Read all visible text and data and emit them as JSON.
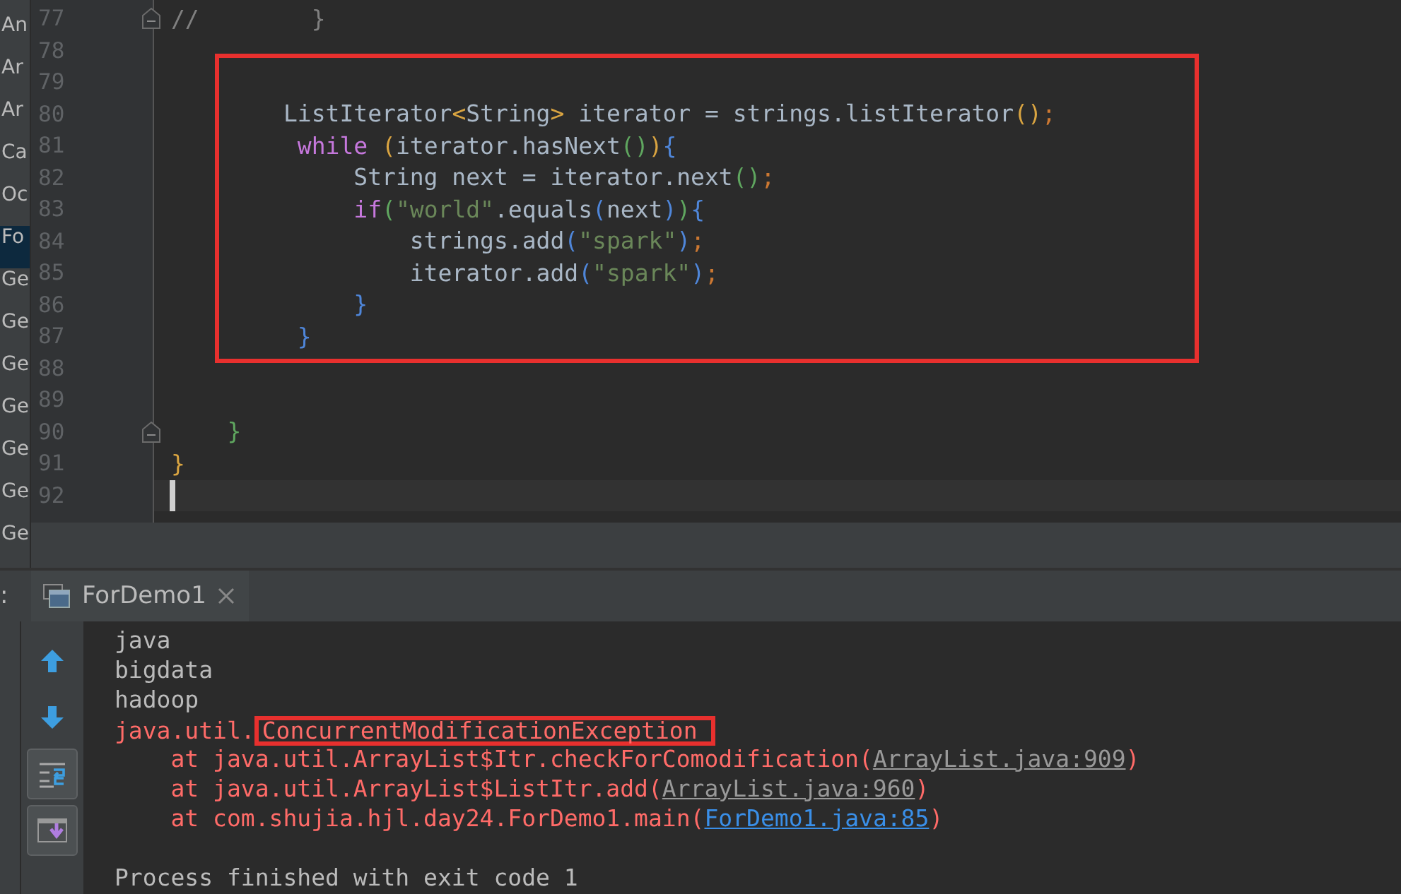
{
  "project_tree": [
    {
      "label": "An",
      "selected": false
    },
    {
      "label": "Ar",
      "selected": false
    },
    {
      "label": "Ar",
      "selected": false
    },
    {
      "label": "Ca",
      "selected": false
    },
    {
      "label": "Oc",
      "selected": false
    },
    {
      "label": "Fo",
      "selected": true
    },
    {
      "label": "Ge",
      "selected": false
    },
    {
      "label": "Ge",
      "selected": false
    },
    {
      "label": "Ge",
      "selected": false
    },
    {
      "label": "Ge",
      "selected": false
    },
    {
      "label": "Ge",
      "selected": false
    },
    {
      "label": "Ge",
      "selected": false
    },
    {
      "label": "Ge",
      "selected": false
    }
  ],
  "editor": {
    "lines": [
      {
        "number": "77",
        "fold": true,
        "current": false,
        "tokens": [
          {
            "text": "//        }",
            "kind": "comment"
          }
        ]
      },
      {
        "number": "78",
        "fold": false,
        "current": false
      },
      {
        "number": "79",
        "fold": false,
        "current": false
      },
      {
        "number": "80",
        "fold": false,
        "current": false,
        "tokens": [
          {
            "text": "        ListIterator",
            "kind": "plain"
          },
          {
            "text": "<",
            "kind": "bracket-gold"
          },
          {
            "text": "String",
            "kind": "plain"
          },
          {
            "text": ">",
            "kind": "bracket-gold"
          },
          {
            "text": " iterator = strings.listIterator",
            "kind": "plain"
          },
          {
            "text": "()",
            "kind": "bracket-gold"
          },
          {
            "text": ";",
            "kind": "semicolon"
          }
        ]
      },
      {
        "number": "81",
        "fold": false,
        "current": false,
        "tokens": [
          {
            "text": "         while",
            "kind": "keyword"
          },
          {
            "text": " (",
            "kind": "bracket-gold"
          },
          {
            "text": "iterator.hasNext",
            "kind": "plain"
          },
          {
            "text": "()",
            "kind": "bracket-green"
          },
          {
            "text": ")",
            "kind": "bracket-gold"
          },
          {
            "text": "{",
            "kind": "bracket-blue"
          }
        ]
      },
      {
        "number": "82",
        "fold": false,
        "current": false,
        "tokens": [
          {
            "text": "             String next = iterator.next",
            "kind": "plain"
          },
          {
            "text": "()",
            "kind": "bracket-green"
          },
          {
            "text": ";",
            "kind": "semicolon"
          }
        ]
      },
      {
        "number": "83",
        "fold": false,
        "current": false,
        "tokens": [
          {
            "text": "             if",
            "kind": "keyword"
          },
          {
            "text": "(",
            "kind": "bracket-green"
          },
          {
            "text": "\"world\"",
            "kind": "string"
          },
          {
            "text": ".equals",
            "kind": "plain"
          },
          {
            "text": "(",
            "kind": "bracket-blue"
          },
          {
            "text": "next",
            "kind": "plain"
          },
          {
            "text": ")",
            "kind": "bracket-blue"
          },
          {
            "text": ")",
            "kind": "bracket-green"
          },
          {
            "text": "{",
            "kind": "bracket-blue"
          }
        ]
      },
      {
        "number": "84",
        "fold": false,
        "current": false,
        "tokens": [
          {
            "text": "                 strings.add",
            "kind": "plain"
          },
          {
            "text": "(",
            "kind": "bracket-blue"
          },
          {
            "text": "\"spark\"",
            "kind": "string"
          },
          {
            "text": ")",
            "kind": "bracket-blue"
          },
          {
            "text": ";",
            "kind": "semicolon"
          }
        ]
      },
      {
        "number": "85",
        "fold": false,
        "current": false,
        "tokens": [
          {
            "text": "                 iterator.add",
            "kind": "plain"
          },
          {
            "text": "(",
            "kind": "bracket-blue"
          },
          {
            "text": "\"spark\"",
            "kind": "string"
          },
          {
            "text": ")",
            "kind": "bracket-blue"
          },
          {
            "text": ";",
            "kind": "semicolon"
          }
        ]
      },
      {
        "number": "86",
        "fold": false,
        "current": false,
        "tokens": [
          {
            "text": "             }",
            "kind": "bracket-blue"
          }
        ]
      },
      {
        "number": "87",
        "fold": false,
        "current": false,
        "tokens": [
          {
            "text": "         }",
            "kind": "bracket-blue"
          }
        ]
      },
      {
        "number": "88",
        "fold": false,
        "current": false
      },
      {
        "number": "89",
        "fold": false,
        "current": false
      },
      {
        "number": "90",
        "fold": true,
        "current": false,
        "tokens": [
          {
            "text": "    }",
            "kind": "bracket-green"
          }
        ]
      },
      {
        "number": "91",
        "fold": false,
        "current": false,
        "tokens": [
          {
            "text": "}",
            "kind": "bracket-gold"
          }
        ]
      },
      {
        "number": "92",
        "fold": false,
        "current": true
      }
    ]
  },
  "run_panel": {
    "label": ":",
    "tab": {
      "label": "ForDemo1"
    },
    "toolbar": [
      {
        "kind": "up",
        "on": false
      },
      {
        "kind": "down",
        "on": false
      },
      {
        "kind": "soft-wrap",
        "on": true
      },
      {
        "kind": "scroll-to-end",
        "on": true
      }
    ],
    "console": [
      {
        "kind": "text",
        "segments": [
          {
            "text": "java",
            "kind": "output",
            "boxed": false
          }
        ]
      },
      {
        "kind": "text",
        "segments": [
          {
            "text": "bigdata",
            "kind": "output",
            "boxed": false
          }
        ]
      },
      {
        "kind": "text",
        "segments": [
          {
            "text": "hadoop",
            "kind": "output",
            "boxed": false
          }
        ]
      },
      {
        "kind": "text",
        "segments": [
          {
            "text": "java.util.",
            "kind": "error",
            "boxed": false
          },
          {
            "text": "ConcurrentModificationException",
            "kind": "error",
            "boxed": true
          }
        ]
      },
      {
        "kind": "text",
        "segments": [
          {
            "text": "    at java.util.ArrayList$Itr.checkForComodification(",
            "kind": "error",
            "boxed": false
          },
          {
            "text": "ArrayList.java:909",
            "kind": "link",
            "boxed": false
          },
          {
            "text": ")",
            "kind": "error",
            "boxed": false
          }
        ]
      },
      {
        "kind": "text",
        "segments": [
          {
            "text": "    at java.util.ArrayList$ListItr.add(",
            "kind": "error",
            "boxed": false
          },
          {
            "text": "ArrayList.java:960",
            "kind": "link",
            "boxed": false
          },
          {
            "text": ")",
            "kind": "error",
            "boxed": false
          }
        ]
      },
      {
        "kind": "text",
        "segments": [
          {
            "text": "    at com.shujia.hjl.day24.ForDemo1.main(",
            "kind": "error",
            "boxed": false
          },
          {
            "text": "ForDemo1.java:85",
            "kind": "source-link",
            "boxed": false
          },
          {
            "text": ")",
            "kind": "error",
            "boxed": false
          }
        ]
      },
      {
        "kind": "blank"
      },
      {
        "kind": "text",
        "segments": [
          {
            "text": "Process finished with exit code 1",
            "kind": "output",
            "boxed": false
          }
        ]
      }
    ]
  }
}
